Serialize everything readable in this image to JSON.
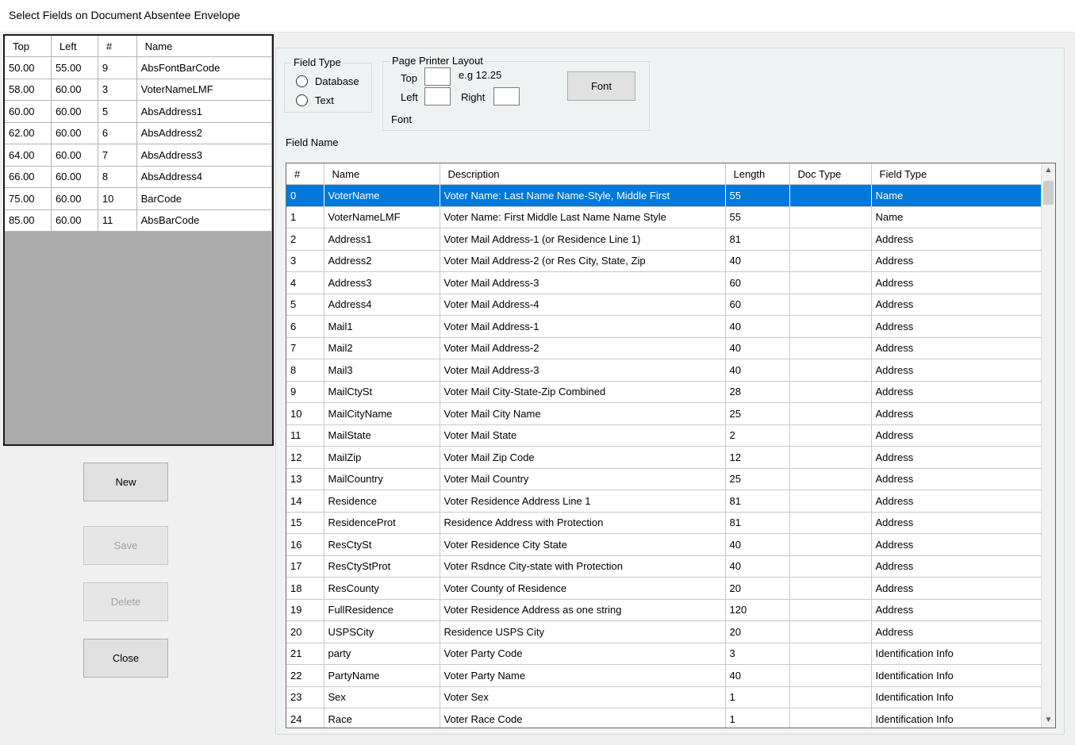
{
  "window": {
    "title": "Select Fields on Document Absentee Envelope"
  },
  "left_grid": {
    "headers": [
      "Top",
      "Left",
      "#",
      "Name"
    ],
    "rows": [
      [
        "50.00",
        "55.00",
        "9",
        "AbsFontBarCode"
      ],
      [
        "58.00",
        "60.00",
        "3",
        "VoterNameLMF"
      ],
      [
        "60.00",
        "60.00",
        "5",
        "AbsAddress1"
      ],
      [
        "62.00",
        "60.00",
        "6",
        "AbsAddress2"
      ],
      [
        "64.00",
        "60.00",
        "7",
        "AbsAddress3"
      ],
      [
        "66.00",
        "60.00",
        "8",
        "AbsAddress4"
      ],
      [
        "75.00",
        "60.00",
        "10",
        "BarCode"
      ],
      [
        "85.00",
        "60.00",
        "11",
        "AbsBarCode"
      ]
    ]
  },
  "buttons": {
    "new": "New",
    "save": "Save",
    "delete": "Delete",
    "close": "Close"
  },
  "field_type": {
    "legend": "Field Type",
    "database": "Database",
    "text": "Text"
  },
  "layout": {
    "legend": "Page Printer Layout",
    "top_label": "Top",
    "left_label": "Left",
    "right_label": "Right",
    "example": "e.g 12.25",
    "font_label": "Font",
    "font_button": "Font",
    "top_value": "",
    "left_value": "",
    "right_value": ""
  },
  "field_name_label": "Field Name",
  "field_grid": {
    "headers": [
      "#",
      "Name",
      "Description",
      "Length",
      "Doc Type",
      "Field Type"
    ],
    "selected_index": 0,
    "rows": [
      [
        "0",
        "VoterName",
        "Voter Name: Last Name Name-Style, Middle First",
        "55",
        "",
        "Name"
      ],
      [
        "1",
        "VoterNameLMF",
        "Voter Name: First Middle Last Name Name Style",
        "55",
        "",
        "Name"
      ],
      [
        "2",
        "Address1",
        "Voter Mail Address-1 (or Residence Line 1)",
        "81",
        "",
        "Address"
      ],
      [
        "3",
        "Address2",
        "Voter Mail Address-2 (or Res City, State, Zip",
        "40",
        "",
        "Address"
      ],
      [
        "4",
        "Address3",
        "Voter Mail Address-3",
        "60",
        "",
        "Address"
      ],
      [
        "5",
        "Address4",
        "Voter Mail Address-4",
        "60",
        "",
        "Address"
      ],
      [
        "6",
        "Mail1",
        "Voter Mail Address-1",
        "40",
        "",
        "Address"
      ],
      [
        "7",
        "Mail2",
        "Voter Mail Address-2",
        "40",
        "",
        "Address"
      ],
      [
        "8",
        "Mail3",
        "Voter Mail Address-3",
        "40",
        "",
        "Address"
      ],
      [
        "9",
        "MailCtySt",
        "Voter Mail City-State-Zip Combined",
        "28",
        "",
        "Address"
      ],
      [
        "10",
        "MailCityName",
        "Voter Mail City Name",
        "25",
        "",
        "Address"
      ],
      [
        "11",
        "MailState",
        "Voter Mail State",
        "2",
        "",
        "Address"
      ],
      [
        "12",
        "MailZip",
        "Voter Mail Zip Code",
        "12",
        "",
        "Address"
      ],
      [
        "13",
        "MailCountry",
        "Voter Mail Country",
        "25",
        "",
        "Address"
      ],
      [
        "14",
        "Residence",
        "Voter Residence Address Line 1",
        "81",
        "",
        "Address"
      ],
      [
        "15",
        "ResidenceProt",
        "Residence Address with Protection",
        "81",
        "",
        "Address"
      ],
      [
        "16",
        "ResCtySt",
        "Voter Residence City State",
        "40",
        "",
        "Address"
      ],
      [
        "17",
        "ResCtyStProt",
        "Voter Rsdnce City-state with Protection",
        "40",
        "",
        "Address"
      ],
      [
        "18",
        "ResCounty",
        "Voter County of Residence",
        "20",
        "",
        "Address"
      ],
      [
        "19",
        "FullResidence",
        "Voter Residence Address as one string",
        "120",
        "",
        "Address"
      ],
      [
        "20",
        "USPSCity",
        "Residence USPS City",
        "20",
        "",
        "Address"
      ],
      [
        "21",
        "party",
        "Voter Party Code",
        "3",
        "",
        "Identification Info"
      ],
      [
        "22",
        "PartyName",
        "Voter Party Name",
        "40",
        "",
        "Identification Info"
      ],
      [
        "23",
        "Sex",
        "Voter Sex",
        "1",
        "",
        "Identification Info"
      ],
      [
        "24",
        "Race",
        "Voter Race Code",
        "1",
        "",
        "Identification Info"
      ]
    ]
  },
  "icons": {
    "scroll_up": "chevron-up-icon",
    "scroll_down": "chevron-down-icon"
  },
  "colors": {
    "selection": "#0078d7",
    "grid_empty": "#ababab"
  }
}
